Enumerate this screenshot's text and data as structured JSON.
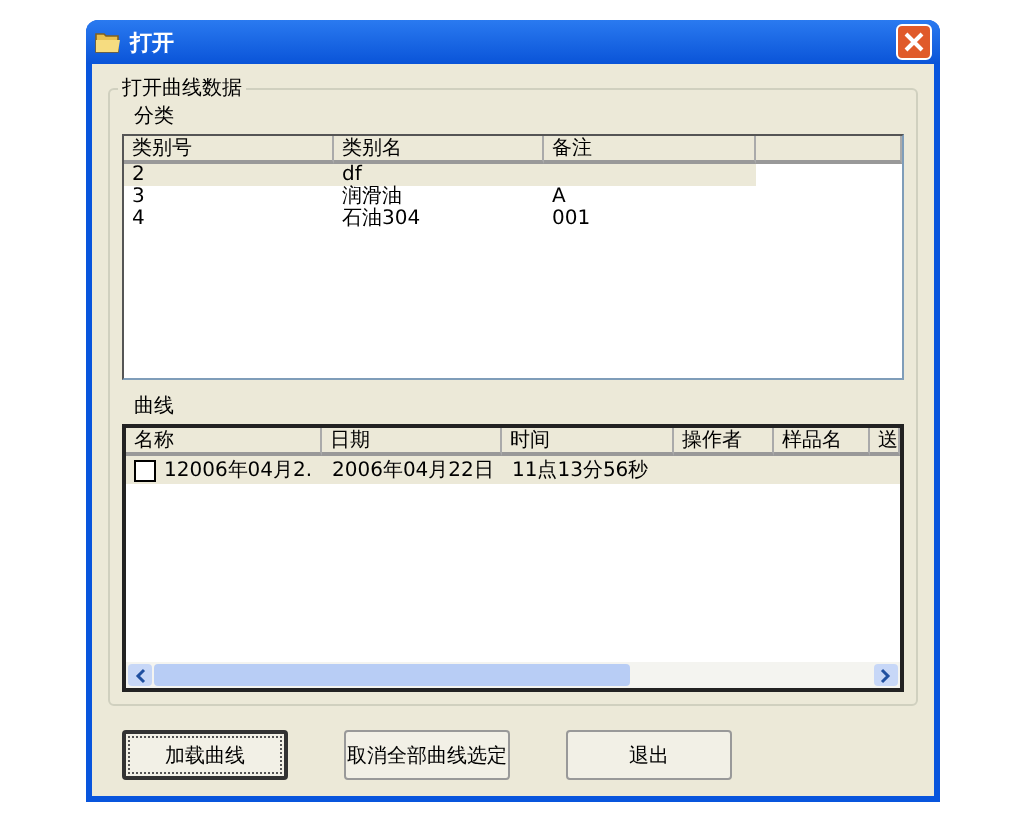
{
  "window": {
    "title": "打开"
  },
  "group": {
    "title": "打开曲线数据"
  },
  "categories": {
    "label": "分类",
    "columns": [
      "类别号",
      "类别名",
      "备注"
    ],
    "rows": [
      {
        "cells": [
          "2",
          "df",
          ""
        ],
        "selected": true
      },
      {
        "cells": [
          "3",
          "润滑油",
          "A"
        ],
        "selected": false
      },
      {
        "cells": [
          "4",
          "石油304",
          "001"
        ],
        "selected": false
      }
    ]
  },
  "curves": {
    "label": "曲线",
    "columns": [
      "名称",
      "日期",
      "时间",
      "操作者",
      "样品名",
      "送"
    ],
    "rows": [
      {
        "cells": [
          "12006年04月2.",
          "2006年04月22日",
          "11点13分56秒",
          "",
          ""
        ],
        "selected": true,
        "checked": false
      }
    ]
  },
  "buttons": [
    {
      "label": "加载曲线",
      "focused": true
    },
    {
      "label": "取消全部曲线选定",
      "focused": false
    },
    {
      "label": "退出",
      "focused": false
    }
  ]
}
